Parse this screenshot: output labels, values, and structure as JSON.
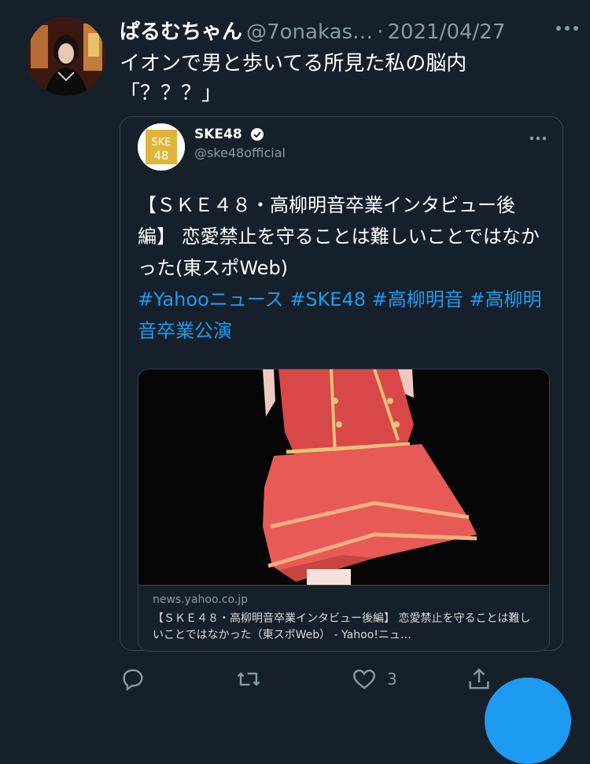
{
  "tweet": {
    "display_name": "ぱるむちゃん",
    "handle": "@7onakas…",
    "separator": "·",
    "date": "2021/04/27",
    "text": "イオンで男と歩いてる所見た私の脳内\n「？？？」"
  },
  "quote": {
    "name": "SKE48",
    "handle": "@ske48official",
    "avatar_text": "SKE48",
    "text": "【ＳＫＥ４８・高柳明音卒業インタビュー後編】 恋愛禁止を守ることは難しいことではなかった(東スポWeb)",
    "hashtags": [
      "#Yahooニュース",
      "#SKE48",
      "#高柳明音",
      "#高柳明音卒業公演"
    ]
  },
  "link_card": {
    "domain": "news.yahoo.co.jp",
    "title": "【ＳＫＥ４８・高柳明音卒業インタビュー後編】 恋愛禁止を守ることは難しいことではなかった（東スポWeb） - Yahoo!ニュ…"
  },
  "actions": {
    "like_count": "3"
  },
  "colors": {
    "background": "#15202b",
    "accent": "#1d9bf0",
    "muted": "#8899a6",
    "border": "#38444d",
    "ske_gold": "#e0b43a"
  },
  "icons": [
    "more-horizontal-icon",
    "verified-badge-icon",
    "reply-icon",
    "retweet-icon",
    "like-icon",
    "share-icon"
  ]
}
